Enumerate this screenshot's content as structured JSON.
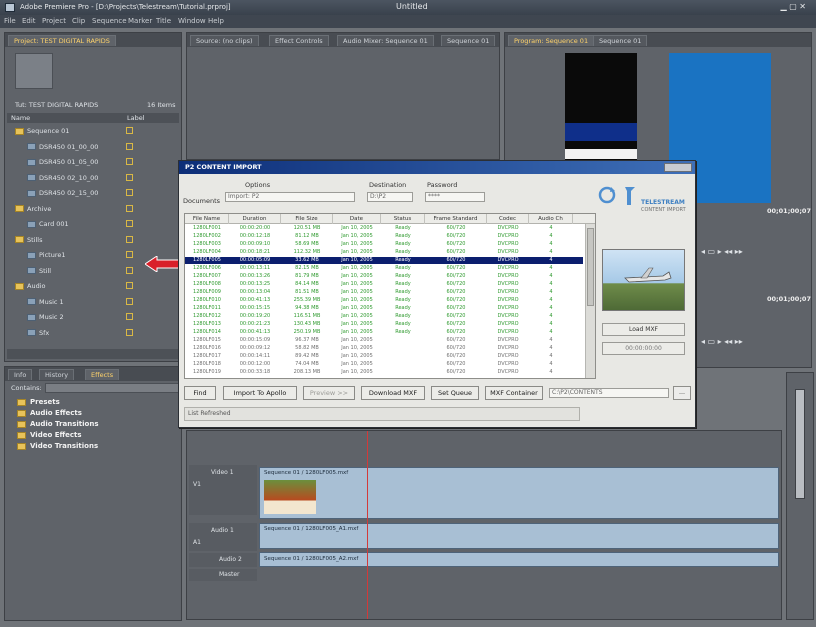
{
  "app": {
    "title": "Adobe Premiere Pro - [D:\\Projects\\Telestream\\Tutorial.prproj]",
    "center_title": "Untitled",
    "menu": [
      "File",
      "Edit",
      "Project",
      "Clip",
      "Sequence",
      "Marker",
      "Title",
      "Window",
      "Help"
    ]
  },
  "project_panel": {
    "tab": "Project: TEST DIGITAL RAPIDS",
    "header_info": "Tut: TEST DIGITAL RAPIDS",
    "items_count": "16 Items",
    "col_name": "Name",
    "col_label": "Label",
    "tree": [
      {
        "name": "Sequence 01",
        "type": "folder"
      },
      {
        "name": "DSR450 01_00_00",
        "type": "clip"
      },
      {
        "name": "DSR450 01_05_00",
        "type": "clip"
      },
      {
        "name": "DSR450 02_10_00",
        "type": "clip"
      },
      {
        "name": "DSR450 02_15_00",
        "type": "clip"
      },
      {
        "name": "Archive",
        "type": "folder"
      },
      {
        "name": "Card 001",
        "type": "clip"
      },
      {
        "name": "Stills",
        "type": "folder"
      },
      {
        "name": "Picture1",
        "type": "clip"
      },
      {
        "name": "Still",
        "type": "clip"
      },
      {
        "name": "Audio",
        "type": "folder"
      },
      {
        "name": "Music 1",
        "type": "clip"
      },
      {
        "name": "Music 2",
        "type": "clip"
      },
      {
        "name": "Sfx",
        "type": "clip"
      }
    ]
  },
  "effects_panel": {
    "tabs": [
      "Info",
      "History",
      "Effects"
    ],
    "contains_label": "Contains:",
    "items": [
      "Presets",
      "Audio Effects",
      "Audio Transitions",
      "Video Effects",
      "Video Transitions"
    ]
  },
  "source_panel": {
    "tabs": [
      "Source: (no clips)",
      "Effect Controls",
      "Audio Mixer: Sequence 01",
      "Sequence 01"
    ]
  },
  "program_panel": {
    "tabs": [
      "Program: Sequence 01",
      "Sequence 01"
    ],
    "timecode_1": "00;01;00;07",
    "timecode_2": "00;01;00;07"
  },
  "dialog": {
    "title": "P2 CONTENT IMPORT",
    "labels": {
      "documents": "Documents",
      "options": "Options",
      "destination": "Destination",
      "password": "Password"
    },
    "fields": {
      "options_value": "Import: P2",
      "destination_value": "D:\\P2",
      "password_value": "****"
    },
    "brand": "TELESTREAM",
    "brand_sub": "CONTENT IMPORT",
    "columns": [
      "File Name",
      "Duration",
      "File Size",
      "Date",
      "Status",
      "Frame Standard",
      "Codec",
      "Audio Ch"
    ],
    "rows": [
      {
        "file": "1280LF001",
        "dur": "00:00:20:00",
        "size": "120.51 MB",
        "date": "Jan 10, 2005",
        "status": "Ready",
        "std": "60i/720",
        "codec": "DVCPRO",
        "audio": "4",
        "state": "ok"
      },
      {
        "file": "1280LF002",
        "dur": "00:00:12:18",
        "size": "81.12 MB",
        "date": "Jan 10, 2005",
        "status": "Ready",
        "std": "60i/720",
        "codec": "DVCPRO",
        "audio": "4",
        "state": "ok"
      },
      {
        "file": "1280LF003",
        "dur": "00:00:09:10",
        "size": "58.69 MB",
        "date": "Jan 10, 2005",
        "status": "Ready",
        "std": "60i/720",
        "codec": "DVCPRO",
        "audio": "4",
        "state": "ok"
      },
      {
        "file": "1280LF004",
        "dur": "00:00:18:21",
        "size": "112.32 MB",
        "date": "Jan 10, 2005",
        "status": "Ready",
        "std": "60i/720",
        "codec": "DVCPRO",
        "audio": "4",
        "state": "ok"
      },
      {
        "file": "1280LF005",
        "dur": "00:00:05:09",
        "size": "33.62 MB",
        "date": "Jan 10, 2005",
        "status": "Ready",
        "std": "60i/720",
        "codec": "DVCPRO",
        "audio": "4",
        "state": "sel"
      },
      {
        "file": "1280LF006",
        "dur": "00:00:13:11",
        "size": "82.15 MB",
        "date": "Jan 10, 2005",
        "status": "Ready",
        "std": "60i/720",
        "codec": "DVCPRO",
        "audio": "4",
        "state": "ok"
      },
      {
        "file": "1280LF007",
        "dur": "00:00:13:26",
        "size": "81.79 MB",
        "date": "Jan 10, 2005",
        "status": "Ready",
        "std": "60i/720",
        "codec": "DVCPRO",
        "audio": "4",
        "state": "ok"
      },
      {
        "file": "1280LF008",
        "dur": "00:00:13:25",
        "size": "84.14 MB",
        "date": "Jan 10, 2005",
        "status": "Ready",
        "std": "60i/720",
        "codec": "DVCPRO",
        "audio": "4",
        "state": "ok"
      },
      {
        "file": "1280LF009",
        "dur": "00:00:13:04",
        "size": "81.51 MB",
        "date": "Jan 10, 2005",
        "status": "Ready",
        "std": "60i/720",
        "codec": "DVCPRO",
        "audio": "4",
        "state": "ok"
      },
      {
        "file": "1280LF010",
        "dur": "00:00:41:13",
        "size": "255.39 MB",
        "date": "Jan 10, 2005",
        "status": "Ready",
        "std": "60i/720",
        "codec": "DVCPRO",
        "audio": "4",
        "state": "ok"
      },
      {
        "file": "1280LF011",
        "dur": "00:00:15:15",
        "size": "94.38 MB",
        "date": "Jan 10, 2005",
        "status": "Ready",
        "std": "60i/720",
        "codec": "DVCPRO",
        "audio": "4",
        "state": "ok"
      },
      {
        "file": "1280LF012",
        "dur": "00:00:19:20",
        "size": "116.51 MB",
        "date": "Jan 10, 2005",
        "status": "Ready",
        "std": "60i/720",
        "codec": "DVCPRO",
        "audio": "4",
        "state": "ok"
      },
      {
        "file": "1280LF013",
        "dur": "00:00:21:23",
        "size": "130.43 MB",
        "date": "Jan 10, 2005",
        "status": "Ready",
        "std": "60i/720",
        "codec": "DVCPRO",
        "audio": "4",
        "state": "ok"
      },
      {
        "file": "1280LF014",
        "dur": "00:00:41:13",
        "size": "250.19 MB",
        "date": "Jan 10, 2005",
        "status": "Ready",
        "std": "60i/720",
        "codec": "DVCPRO",
        "audio": "4",
        "state": "ok"
      },
      {
        "file": "1280LF015",
        "dur": "00:00:15:09",
        "size": "96.37 MB",
        "date": "Jan 10, 2005",
        "status": "",
        "std": "60i/720",
        "codec": "DVCPRO",
        "audio": "4",
        "state": "plain"
      },
      {
        "file": "1280LF016",
        "dur": "00:00:09:12",
        "size": "58.82 MB",
        "date": "Jan 10, 2005",
        "status": "",
        "std": "60i/720",
        "codec": "DVCPRO",
        "audio": "4",
        "state": "plain"
      },
      {
        "file": "1280LF017",
        "dur": "00:00:14:11",
        "size": "89.42 MB",
        "date": "Jan 10, 2005",
        "status": "",
        "std": "60i/720",
        "codec": "DVCPRO",
        "audio": "4",
        "state": "plain"
      },
      {
        "file": "1280LF018",
        "dur": "00:00:12:00",
        "size": "74.04 MB",
        "date": "Jan 10, 2005",
        "status": "",
        "std": "60i/720",
        "codec": "DVCPRO",
        "audio": "4",
        "state": "plain"
      },
      {
        "file": "1280LF019",
        "dur": "00:00:33:18",
        "size": "208.13 MB",
        "date": "Jan 10, 2005",
        "status": "",
        "std": "60i/720",
        "codec": "DVCPRO",
        "audio": "4",
        "state": "plain"
      }
    ],
    "preview_btn_1": "Load MXF",
    "preview_btn_2": "00:00:00:00",
    "buttons": {
      "find": "Find",
      "import_to_apollo": "Import To Apollo",
      "preview": "Preview >>",
      "download_mxf": "Download MXF",
      "set_queue": "Set Queue",
      "mxf_container": "MXF Container"
    },
    "path_value": "C:\\P2\\CONTENTS",
    "status_text": "List Refreshed"
  },
  "timeline": {
    "video_track": "Video 1",
    "video_clip": "Sequence 01 / 1280LF005.mxf",
    "audio_track_1": "Audio 1",
    "audio_track_2": "Audio 2",
    "audio_clip_1": "Sequence 01 / 1280LF005_A1.mxf",
    "audio_clip_2": "Sequence 01 / 1280LF005_A2.mxf",
    "master": "Master",
    "zoom_v": "V1",
    "zoom_a": "A1"
  }
}
